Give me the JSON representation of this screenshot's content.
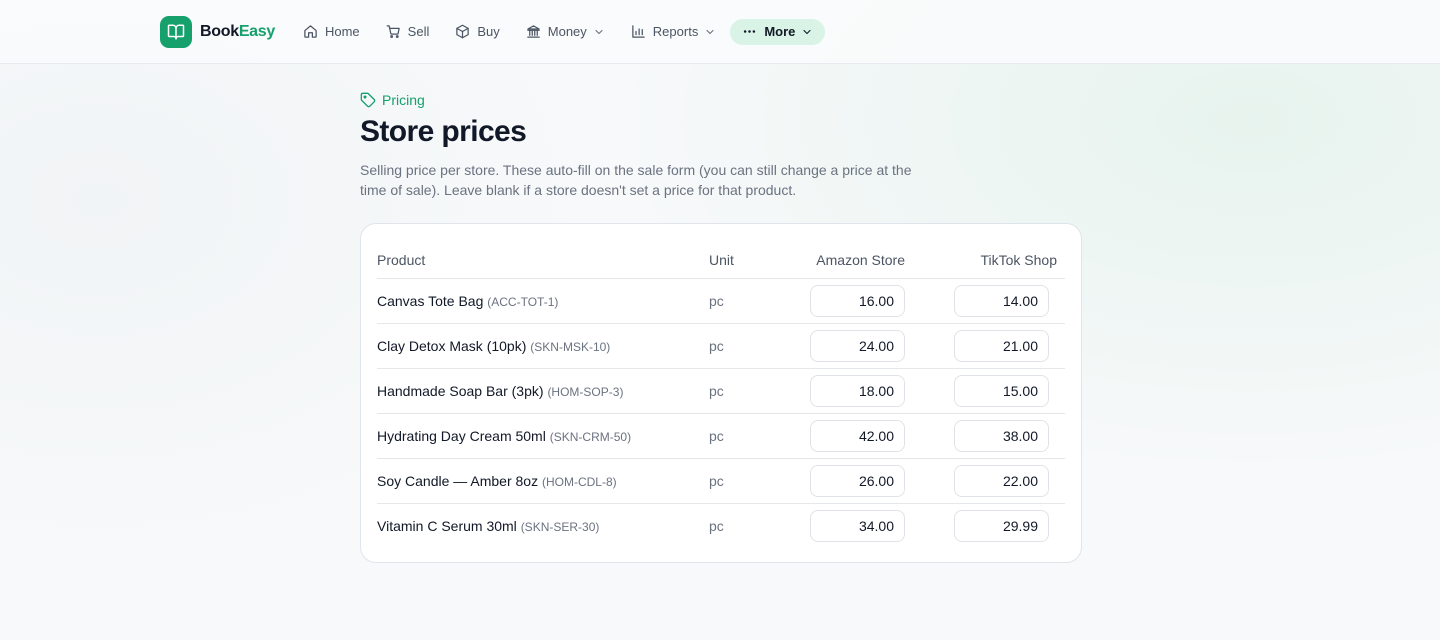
{
  "brand": {
    "name_part1": "Book",
    "name_part2": "Easy",
    "logo_icon": "open-book-icon",
    "accent": "#16a06b"
  },
  "nav": {
    "items": [
      {
        "id": "home",
        "label": "Home",
        "icon": "home-icon",
        "dropdown": false
      },
      {
        "id": "sell",
        "label": "Sell",
        "icon": "cart-icon",
        "dropdown": false
      },
      {
        "id": "buy",
        "label": "Buy",
        "icon": "package-icon",
        "dropdown": false
      },
      {
        "id": "money",
        "label": "Money",
        "icon": "bank-icon",
        "dropdown": true
      },
      {
        "id": "reports",
        "label": "Reports",
        "icon": "bar-chart-icon",
        "dropdown": true
      },
      {
        "id": "more",
        "label": "More",
        "icon": "dots-icon",
        "dropdown": true,
        "active": true
      }
    ]
  },
  "page": {
    "eyebrow": "Pricing",
    "eyebrow_icon": "tag-icon",
    "title": "Store prices",
    "subtitle": "Selling price per store. These auto-fill on the sale form (you can still change a price at the time of sale). Leave blank if a store doesn't set a price for that product."
  },
  "table": {
    "headers": {
      "product": "Product",
      "unit": "Unit",
      "store1": "Amazon Store",
      "store2": "TikTok Shop"
    },
    "rows": [
      {
        "name": "Canvas Tote Bag",
        "sku": "(ACC-TOT-1)",
        "unit": "pc",
        "amazon": "16.00",
        "tiktok": "14.00"
      },
      {
        "name": "Clay Detox Mask (10pk)",
        "sku": "(SKN-MSK-10)",
        "unit": "pc",
        "amazon": "24.00",
        "tiktok": "21.00"
      },
      {
        "name": "Handmade Soap Bar (3pk)",
        "sku": "(HOM-SOP-3)",
        "unit": "pc",
        "amazon": "18.00",
        "tiktok": "15.00"
      },
      {
        "name": "Hydrating Day Cream 50ml",
        "sku": "(SKN-CRM-50)",
        "unit": "pc",
        "amazon": "42.00",
        "tiktok": "38.00"
      },
      {
        "name": "Soy Candle — Amber 8oz",
        "sku": "(HOM-CDL-8)",
        "unit": "pc",
        "amazon": "26.00",
        "tiktok": "22.00"
      },
      {
        "name": "Vitamin C Serum 30ml",
        "sku": "(SKN-SER-30)",
        "unit": "pc",
        "amazon": "34.00",
        "tiktok": "29.99"
      }
    ]
  }
}
